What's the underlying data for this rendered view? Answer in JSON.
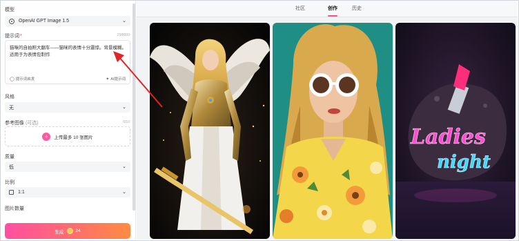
{
  "sidebar": {
    "model": {
      "label": "模型",
      "value": "OpenAI GPT Image 1.5"
    },
    "prompt": {
      "label": "提示词",
      "required_mark": "*",
      "counter": "29/8000",
      "text": "猫咪的自拍照大翻车——猫咪的表情十分震惊。背景模糊。适用于为表情包制作",
      "inspiration_label": "提示词启发",
      "ai_prompt_label": "AI提示词"
    },
    "style": {
      "label": "风格",
      "value": "无"
    },
    "reference": {
      "label": "参考图像",
      "optional": "(可选)",
      "counter": "0/10",
      "upload_label": "上传最多 10 张图片"
    },
    "quality": {
      "label": "质量",
      "value": "低"
    },
    "ratio": {
      "label": "比例",
      "value": "1:1"
    },
    "count": {
      "label": "图片数量"
    },
    "generate": {
      "label": "生成",
      "cost": "24"
    }
  },
  "main": {
    "tabs": [
      {
        "label": "社区"
      },
      {
        "label": "创作"
      },
      {
        "label": "历史"
      }
    ],
    "active_tab": "创作",
    "cards": [
      {
        "subject": "golden-armored-angel-warrior"
      },
      {
        "subject": "woman-white-sunglasses-teal"
      },
      {
        "subject": "neon-lipstick-sign",
        "neon_line1": "Ladies",
        "neon_line2": "night"
      }
    ]
  },
  "colors": {
    "accent": "#ff4f88",
    "generate_start": "#ff4fa3",
    "generate_end": "#ff8c42",
    "arrow": "#e02424"
  }
}
